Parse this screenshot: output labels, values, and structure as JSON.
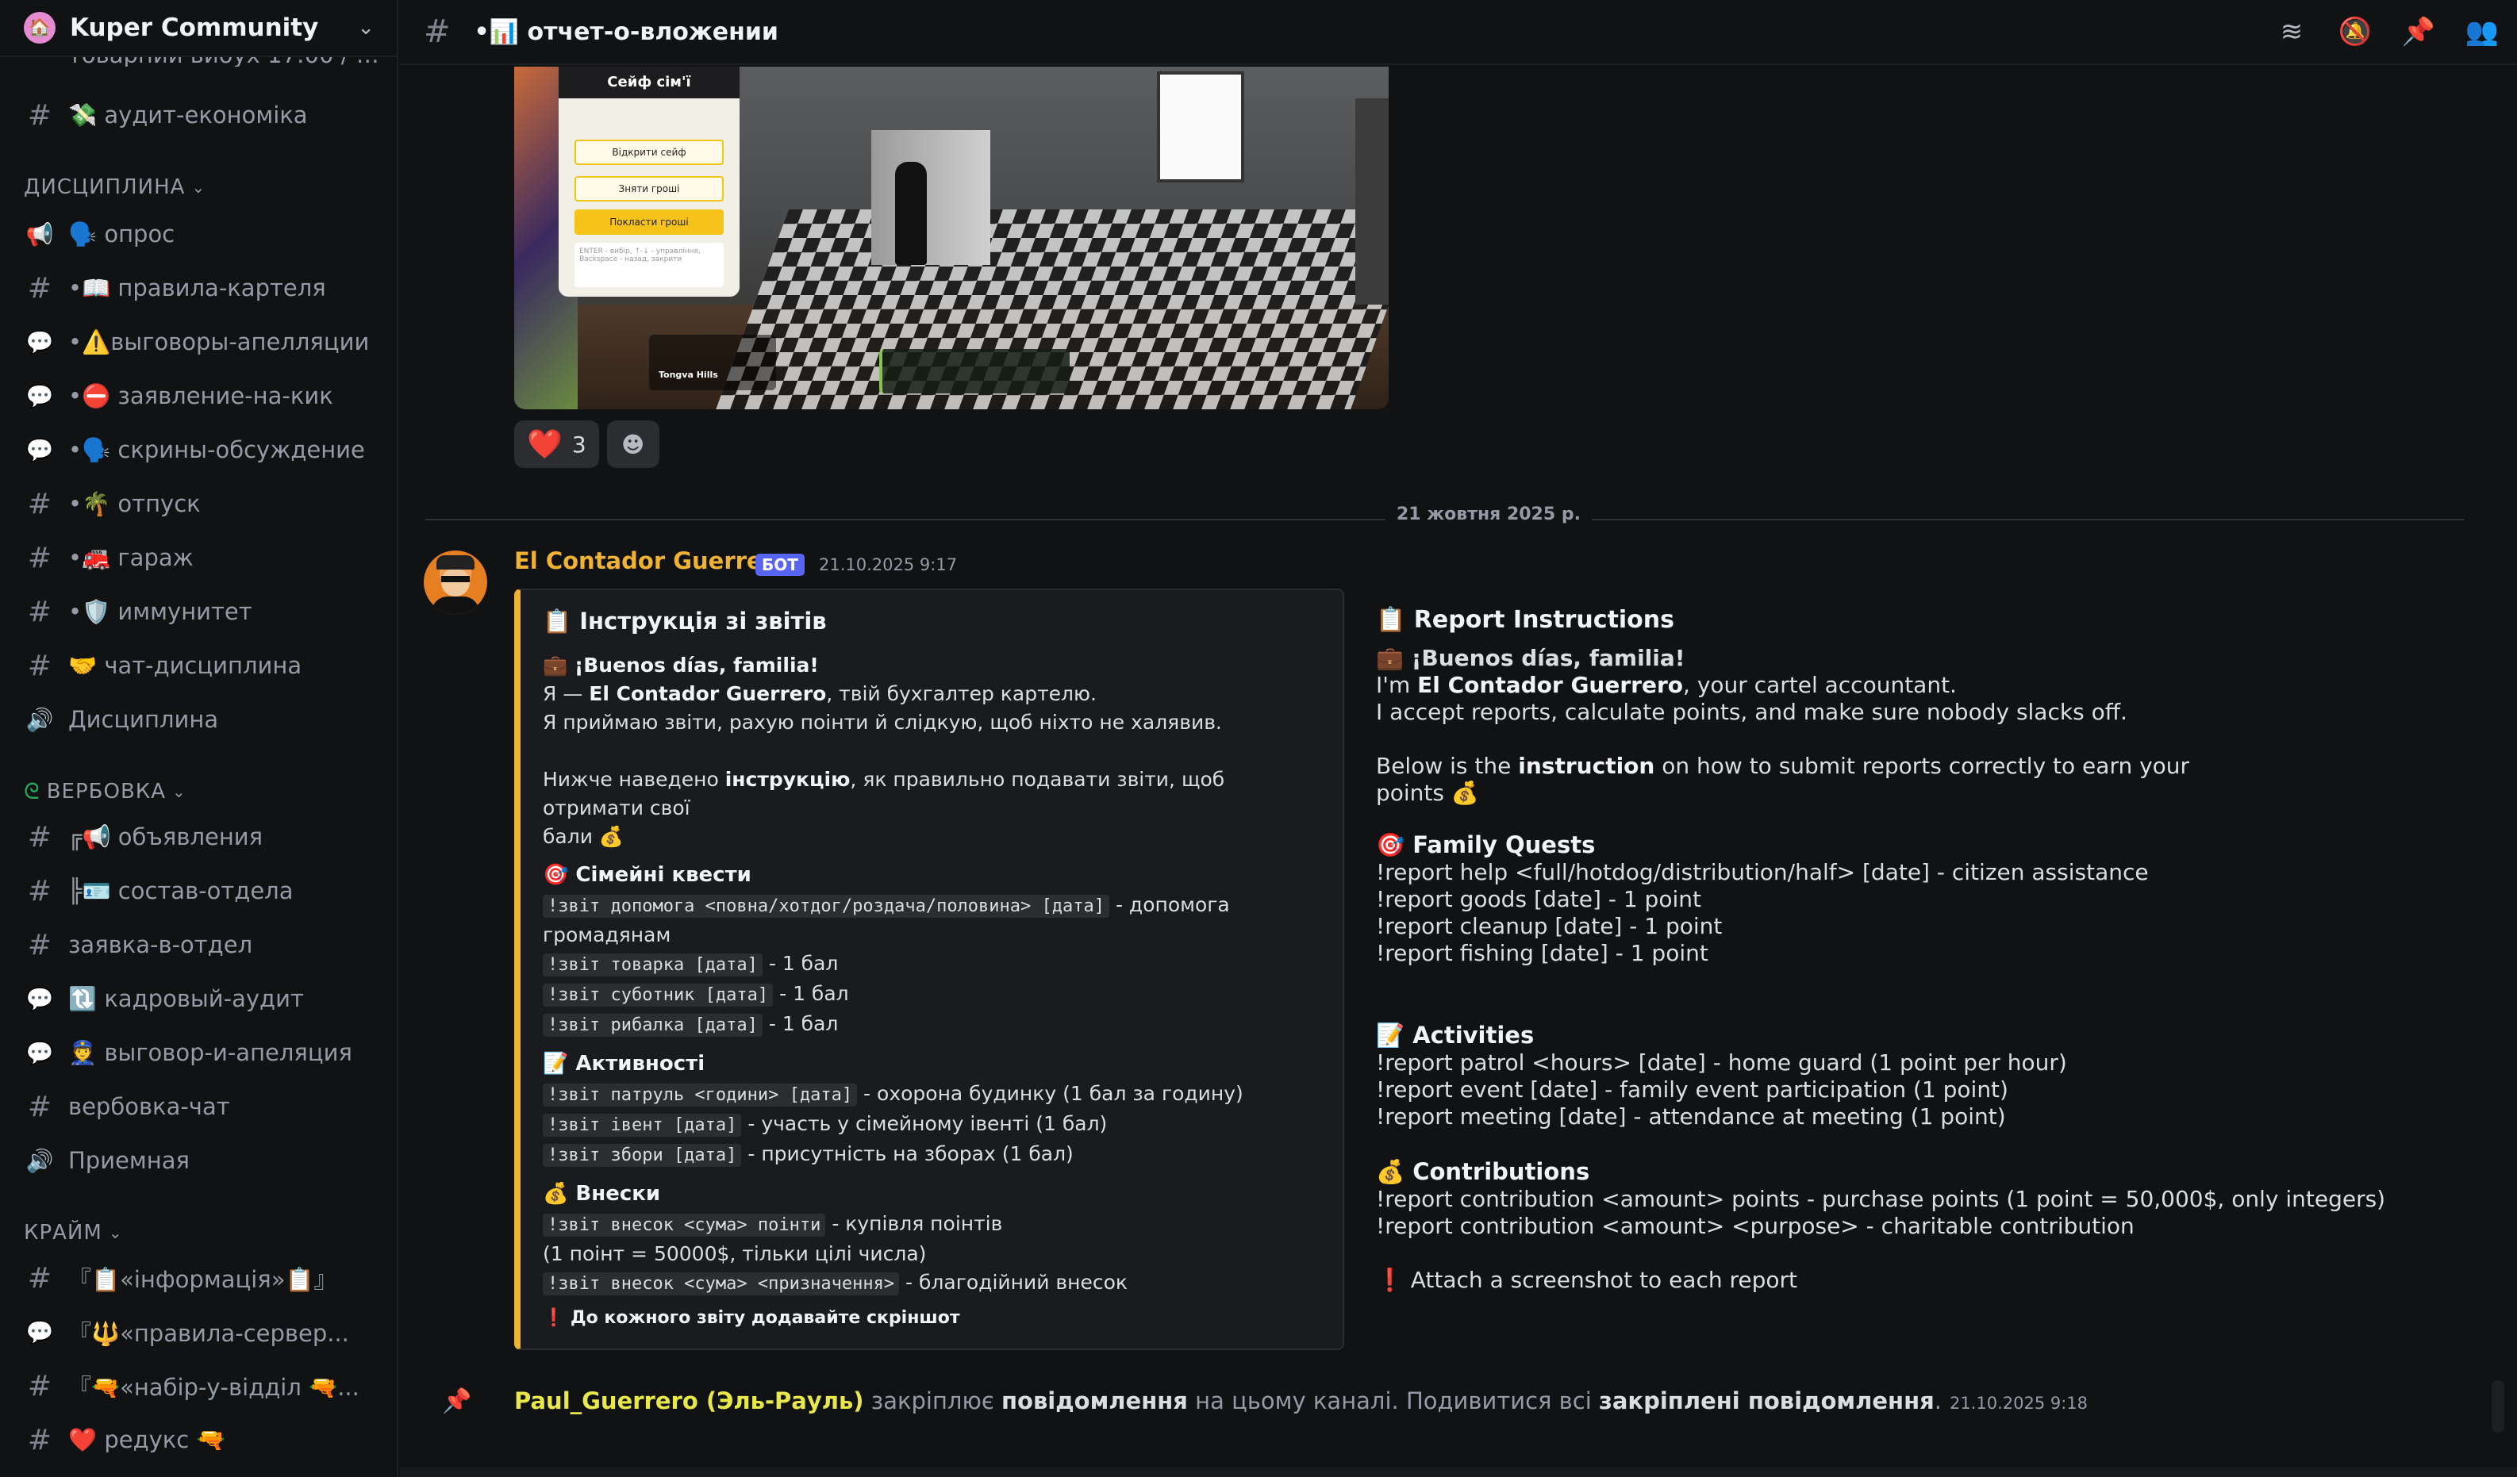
{
  "server": {
    "name": "Kuper Community",
    "icon": "🏠"
  },
  "sidebar": {
    "clipped_channel": "товарний виоух 17:00 / 2...",
    "channels_top": [
      {
        "icon": "#",
        "label": "💸 аудит-економіка"
      }
    ],
    "categories": [
      {
        "name": "ДИСЦИПЛИНА",
        "channels": [
          {
            "icon": "📢",
            "label": "🗣️ опрос"
          },
          {
            "icon": "#",
            "label": "•📖 правила-картеля"
          },
          {
            "icon": "💬",
            "label": "•⚠️выговоры-апелляции"
          },
          {
            "icon": "💬",
            "label": "•⛔ заявление-на-кик"
          },
          {
            "icon": "💬",
            "label": "•🗣️ скрины-обсуждение"
          },
          {
            "icon": "#",
            "label": "•🌴 отпуск"
          },
          {
            "icon": "#",
            "label": "•🚒 гараж"
          },
          {
            "icon": "#",
            "label": "•🛡️ иммунитет"
          },
          {
            "icon": "#",
            "label": "🤝 чат-дисциплина"
          },
          {
            "icon": "🔊",
            "label": "Дисциплина"
          }
        ]
      },
      {
        "name": "ВЕРБОВКА",
        "channels": [
          {
            "icon": "#",
            "label": "╔📢 объявления"
          },
          {
            "icon": "#",
            "label": "╠🪪 состав-отдела"
          },
          {
            "icon": "#",
            "label": "заявка-в-отдел"
          },
          {
            "icon": "💬",
            "label": "🔃 кадровый-аудит"
          },
          {
            "icon": "💬",
            "label": "👮 выговор-и-апеляция"
          },
          {
            "icon": "#",
            "label": "вербовка-чат"
          },
          {
            "icon": "🔊",
            "label": "Приемная"
          }
        ]
      },
      {
        "name": "КРАЙМ",
        "channels": [
          {
            "icon": "#",
            "label": "『📋«інформація»📋』"
          },
          {
            "icon": "💬",
            "label": "『🔱«правила-сервер..."
          },
          {
            "icon": "#",
            "label": "『🔫«набір-у-відділ 🔫..."
          },
          {
            "icon": "#",
            "label": "❤️ редукс 🔫"
          }
        ]
      }
    ]
  },
  "topbar": {
    "channel_name": "•📊 отчет-о-вложении",
    "icons": [
      "threads-icon",
      "mute-icon",
      "pin-icon",
      "members-icon"
    ]
  },
  "attachment": {
    "panel_title": "Сейф сім'ї",
    "buttons": [
      "Відкрити сейф",
      "Зняти гроші",
      "Покласти гроші"
    ],
    "note": "ENTER - вибір, ↑-↓ - управління, Backspace - назад, закрити",
    "location": "Tongva Hills"
  },
  "reactions": [
    {
      "emoji": "❤️",
      "count": "3"
    }
  ],
  "date_divider": "21 жовтня 2025 р.",
  "message": {
    "author": "El Contador Guerrero",
    "tag": "БОТ",
    "timestamp": "21.10.2025 9:17",
    "embed_uk": {
      "title": "📋 Інструкція зі звітів",
      "greeting": "💼 ¡Buenos días, familia!",
      "intro_prefix": "Я — ",
      "intro_name": "El Contador Guerrero",
      "intro_suffix": ", твій бухгалтер картелю.",
      "intro2": "Я приймаю звіти, рахую поінти й слідкую, щоб ніхто не халявив.",
      "howto_prefix": "Нижче наведено ",
      "howto_bold": "інструкцію",
      "howto_suffix": ", як правильно подавати звіти, щоб отримати свої",
      "howto_end": "бали 💰",
      "sec1": "🎯 Сімейні квести",
      "c1": "!звіт допомога <повна/хотдог/роздача/половина> [дата]",
      "c1d": " - допомога",
      "c1d2": "громадянам",
      "c2": "!звіт товарка [дата]",
      "c2d": " - 1 бал",
      "c3": "!звіт суботник [дата]",
      "c3d": " - 1 бал",
      "c4": "!звіт рибалка [дата]",
      "c4d": " - 1 бал",
      "sec2": "📝 Активності",
      "c5": "!звіт патруль <години> [дата]",
      "c5d": " - охорона будинку (1 бал за годину)",
      "c6": "!звіт івент [дата]",
      "c6d": " - участь у сімейному івенті (1 бал)",
      "c7": "!звіт збори [дата]",
      "c7d": " - присутність на зборах (1 бал)",
      "sec3": "💰 Внески",
      "c8": "!звіт внесок <сума> поінти",
      "c8d": " - купівля поінтів",
      "c8d2": "(1 поінт = 50000$, тільки цілі числа)",
      "c9": "!звіт внесок <сума> <призначення>",
      "c9d": " - благодійний внесок",
      "note": "❗ До кожного звіту додавайте скріншот"
    },
    "embed_en": {
      "title": "📋 Report Instructions",
      "greeting": "💼 ¡Buenos días, familia!",
      "intro_prefix": "I'm ",
      "intro_name": "El Contador Guerrero",
      "intro_suffix": ", your cartel accountant.",
      "intro2": "I accept reports, calculate points, and make sure nobody slacks off.",
      "howto_prefix": "Below is the ",
      "howto_bold": "instruction",
      "howto_suffix": " on how to submit reports correctly to earn your",
      "howto_end": "points 💰",
      "sec1": "🎯 Family Quests",
      "l1": "!report help <full/hotdog/distribution/half> [date] - citizen assistance",
      "l2": "!report goods [date] - 1 point",
      "l3": "!report cleanup [date] - 1 point",
      "l4": "!report fishing [date] - 1 point",
      "sec2": "📝 Activities",
      "l5": "!report patrol <hours> [date] - home guard (1 point per hour)",
      "l6": "!report event [date] - family event participation (1 point)",
      "l7": "!report meeting [date] - attendance at meeting (1 point)",
      "sec3": "💰 Contributions",
      "l8": "!report contribution <amount> points - purchase points (1 point = 50,000$, only integers)",
      "l9": "!report contribution <amount> <purpose> - charitable contribution",
      "note": "❗ Attach a screenshot to each report"
    }
  },
  "pin_notice": {
    "user": "Paul_Guerrero (Эль-Рауль)",
    "t1": " закріплює ",
    "b1": "повідомлення",
    "t2": " на цьому каналі. Подивитися всі ",
    "b2": "закріплені повідомлення",
    "t3": ".",
    "time": "21.10.2025 9:18"
  }
}
